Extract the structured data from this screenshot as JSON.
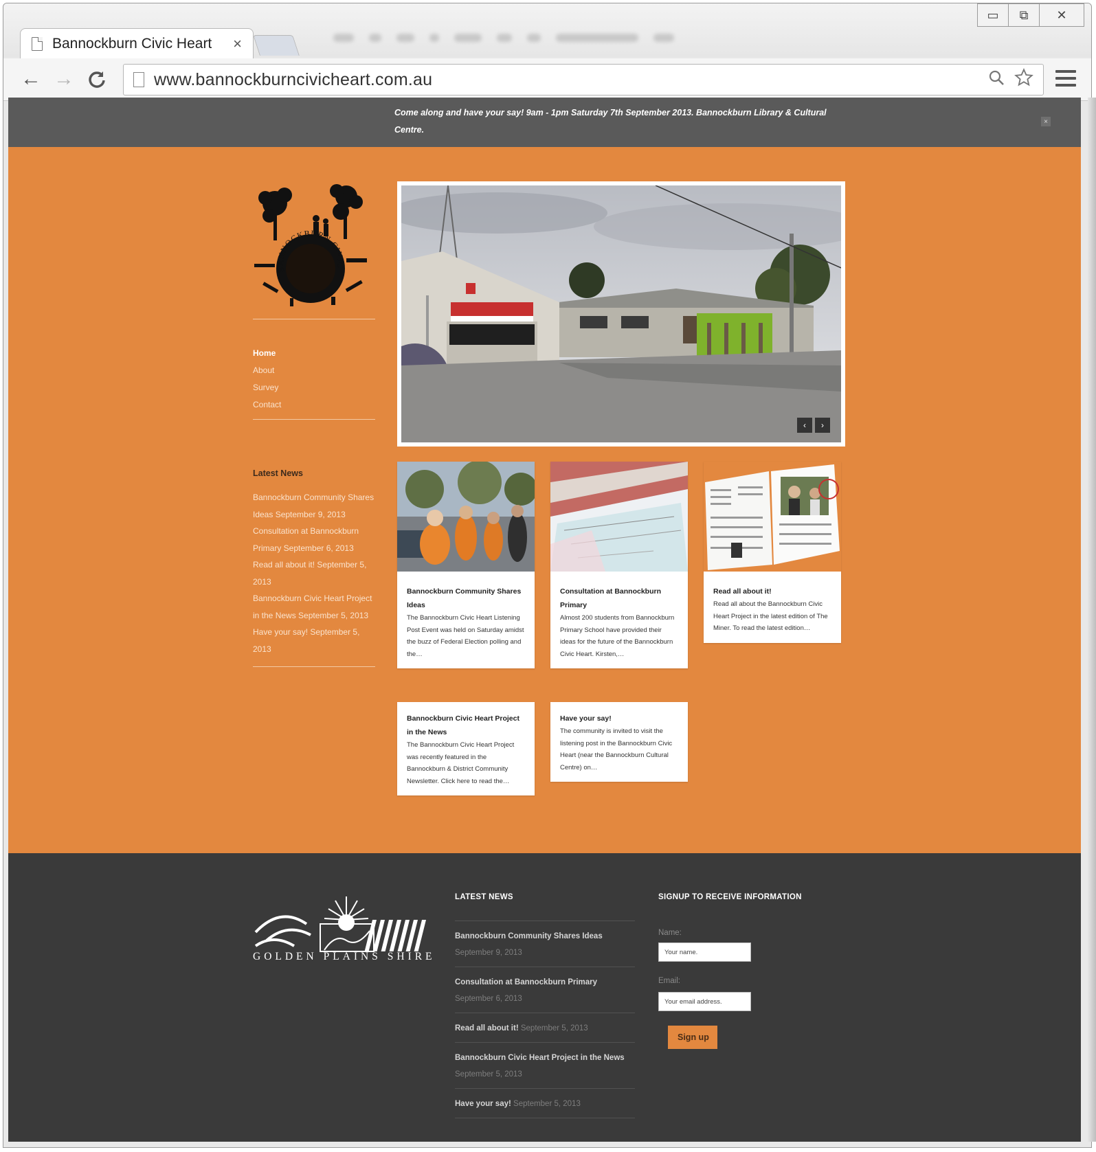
{
  "browser": {
    "tab_title": "Bannockburn Civic Heart",
    "tab_close": "×",
    "url": "www.bannockburncivicheart.com.au",
    "back": "←",
    "forward": "→",
    "reload": "C",
    "search_icon": "search-icon",
    "star_icon": "star-icon",
    "menu_icon": "menu-icon"
  },
  "announcement": {
    "text": "Come along and have your say! 9am - 1pm Saturday 7th September 2013. Bannockburn Library & Cultural Centre.",
    "close": "×"
  },
  "sidebar": {
    "nav": [
      "Home",
      "About",
      "Survey",
      "Contact"
    ],
    "latest_news_heading": "Latest News",
    "latest_news": [
      "Bannockburn Community Shares Ideas September 9, 2013",
      "Consultation at Bannockburn Primary September 6, 2013",
      "Read all about it! September 5, 2013",
      "Bannockburn Civic Heart Project in the News September 5, 2013",
      "Have your say! September 5, 2013"
    ]
  },
  "slider": {
    "prev": "‹",
    "next": "›"
  },
  "cards": [
    {
      "title": "Bannockburn Community Shares Ideas",
      "excerpt": "The Bannockburn Civic Heart Listening Post Event was held on Saturday amidst the buzz of Federal Election polling and the…"
    },
    {
      "title": "Consultation at Bannockburn Primary",
      "excerpt": "Almost 200 students from Bannockburn Primary School have provided their ideas for the future of the Bannockburn Civic Heart. Kirsten,…"
    },
    {
      "title": "Read all about it!",
      "excerpt": "Read all about the Bannockburn Civic Heart Project in the latest edition of The Miner. To read the latest edition…"
    },
    {
      "title": "Bannockburn Civic Heart Project in the News",
      "excerpt": "The Bannockburn Civic Heart Project was recently featured in the Bannockburn & District Community Newsletter. Click here to read the…"
    },
    {
      "title": "Have your say!",
      "excerpt": "The community is invited to visit the listening post in the Bannockburn Civic Heart (near the Bannockburn Cultural Centre) on…"
    }
  ],
  "footer": {
    "shire_name": "GOLDEN PLAINS SHIRE",
    "news_heading": "LATEST NEWS",
    "news": [
      {
        "title": "Bannockburn Community Shares Ideas",
        "date": "September 9, 2013"
      },
      {
        "title": "Consultation at Bannockburn Primary",
        "date": "September 6, 2013"
      },
      {
        "title": "Read all about it!",
        "date": "September 5, 2013"
      },
      {
        "title": "Bannockburn Civic Heart Project in the News",
        "date": "September 5, 2013"
      },
      {
        "title": "Have your say!",
        "date": "September 5, 2013"
      }
    ],
    "signup_heading": "SIGNUP TO RECEIVE INFORMATION",
    "name_label": "Name:",
    "name_placeholder": "Your name.",
    "email_label": "Email:",
    "email_placeholder": "Your email address.",
    "signup_button": "Sign up"
  },
  "colors": {
    "page_orange": "#e3883f",
    "announcement_bar": "#5a5a5a",
    "footer_dark": "#3a3a3a"
  }
}
